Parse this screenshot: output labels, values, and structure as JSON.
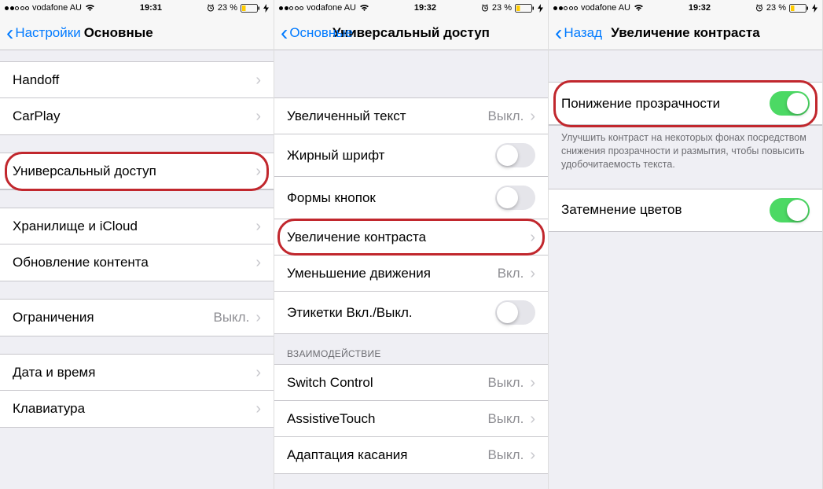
{
  "screens": [
    {
      "status": {
        "carrier": "vodafone AU",
        "time": "19:31",
        "battery": "23 %"
      },
      "nav": {
        "back": "Настройки",
        "title": "Основные"
      },
      "groups": [
        {
          "rows": [
            {
              "label": "Handoff"
            },
            {
              "label": "CarPlay"
            }
          ]
        },
        {
          "rows": [
            {
              "label": "Универсальный доступ",
              "highlight": true
            }
          ]
        },
        {
          "rows": [
            {
              "label": "Хранилище и iCloud"
            },
            {
              "label": "Обновление контента"
            }
          ]
        },
        {
          "rows": [
            {
              "label": "Ограничения",
              "value": "Выкл."
            }
          ]
        },
        {
          "rows": [
            {
              "label": "Дата и время"
            },
            {
              "label": "Клавиатура"
            }
          ]
        }
      ]
    },
    {
      "status": {
        "carrier": "vodafone AU",
        "time": "19:32",
        "battery": "23 %"
      },
      "nav": {
        "back": "Основные",
        "title": "Универсальный доступ"
      },
      "groups": [
        {
          "rows": [
            {
              "label": "Увеличенный текст",
              "value": "Выкл."
            },
            {
              "label": "Жирный шрифт",
              "toggle": false
            },
            {
              "label": "Формы кнопок",
              "toggle": false
            },
            {
              "label": "Увеличение контраста",
              "highlight": true
            },
            {
              "label": "Уменьшение движения",
              "value": "Вкл."
            },
            {
              "label": "Этикетки Вкл./Выкл.",
              "toggle": false
            }
          ]
        },
        {
          "header": "ВЗАИМОДЕЙСТВИЕ",
          "rows": [
            {
              "label": "Switch Control",
              "value": "Выкл."
            },
            {
              "label": "AssistiveTouch",
              "value": "Выкл."
            },
            {
              "label": "Адаптация касания",
              "value": "Выкл."
            }
          ]
        }
      ]
    },
    {
      "status": {
        "carrier": "vodafone AU",
        "time": "19:32",
        "battery": "23 %"
      },
      "nav": {
        "back": "Назад",
        "title": "Увеличение контраста"
      },
      "groups": [
        {
          "rows": [
            {
              "label": "Понижение прозрачности",
              "toggle": true,
              "highlight": true
            }
          ],
          "footer": "Улучшить контраст на некоторых фонах посредством снижения прозрачности и размытия, чтобы повысить удобочитаемость текста."
        },
        {
          "rows": [
            {
              "label": "Затемнение цветов",
              "toggle": true
            }
          ]
        }
      ]
    }
  ]
}
